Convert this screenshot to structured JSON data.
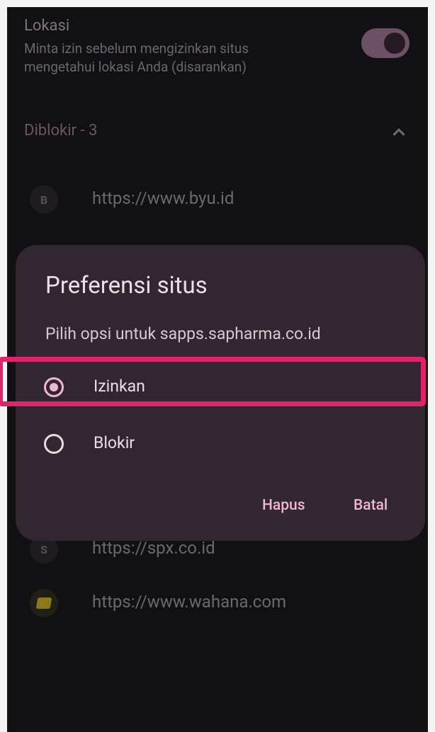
{
  "location": {
    "title": "Lokasi",
    "description": "Minta izin sebelum mengizinkan situs mengetahui lokasi Anda (disarankan)",
    "toggle_on": true
  },
  "blocked": {
    "header": "Diblokir - 3",
    "sites": [
      {
        "initial": "B",
        "url": "https://www.byu.id"
      },
      {
        "initial": "S",
        "url": "https://spx.co.id"
      },
      {
        "initial": "",
        "url": "https://www.wahana.com"
      }
    ]
  },
  "dialog": {
    "title": "Preferensi situs",
    "subtitle": "Pilih opsi untuk sapps.sapharma.co.id",
    "options": [
      {
        "label": "Izinkan",
        "selected": true
      },
      {
        "label": "Blokir",
        "selected": false
      }
    ],
    "buttons": {
      "delete": "Hapus",
      "cancel": "Batal"
    }
  },
  "colors": {
    "accent": "#f1b6d6",
    "highlight": "#e0236a",
    "dialog_bg": "#322630",
    "screen_bg": "#111012"
  }
}
